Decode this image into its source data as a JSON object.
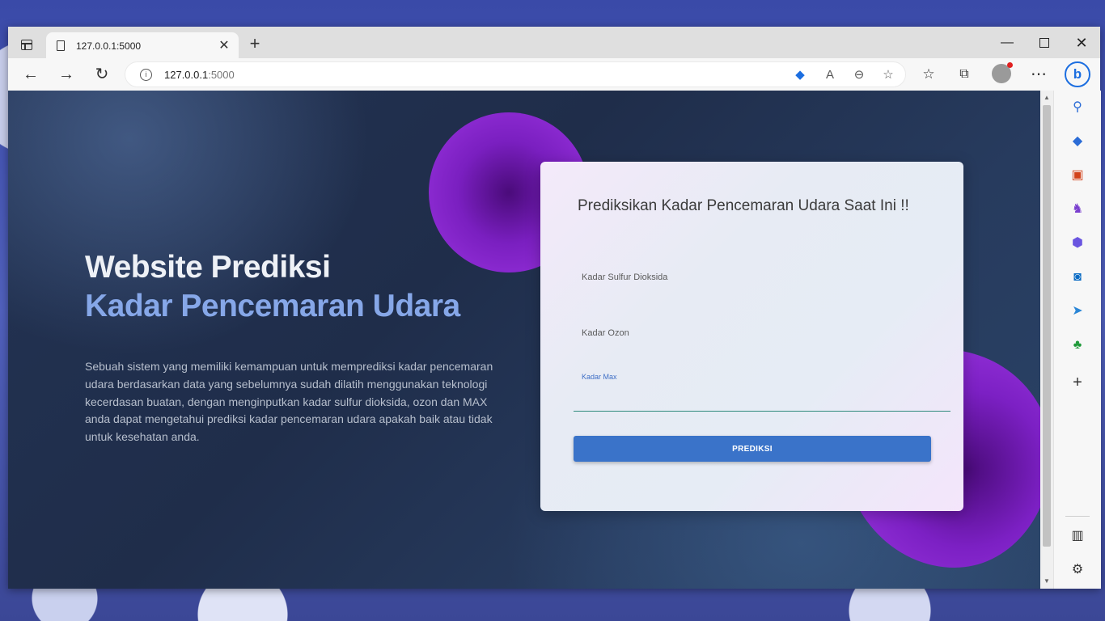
{
  "browser": {
    "tab": {
      "title": "127.0.0.1:5000"
    },
    "address": {
      "host": "127.0.0.1",
      "port": ":5000"
    },
    "buttons": {
      "back": "←",
      "forward": "→",
      "refresh": "↻",
      "new_tab": "+",
      "minimize": "—",
      "close": "✕",
      "more": "⋯",
      "tab_close": "✕"
    },
    "address_icons": [
      "coupon-tag-icon",
      "read-aloud-icon",
      "zoom-out-icon",
      "add-favorite-icon"
    ],
    "toolbar_icons": [
      "favorites-icon",
      "collections-icon",
      "profile-icon",
      "more-icon",
      "bing-copilot-icon"
    ]
  },
  "sidebar": {
    "items": [
      "search-icon",
      "shopping-tag-icon",
      "tools-icon",
      "games-icon",
      "office-icon",
      "outlook-icon",
      "telegram-icon",
      "tree-icon",
      "add-icon"
    ],
    "bottom": [
      "split-screen-icon",
      "settings-icon"
    ]
  },
  "hero": {
    "title": "Website Prediksi",
    "subtitle": "Kadar Pencemaran Udara",
    "description": "Sebuah sistem yang memiliki kemampuan untuk memprediksi kadar pencemaran udara berdasarkan data yang sebelumnya sudah dilatih menggunakan teknologi kecerdasan buatan, dengan menginputkan kadar sulfur dioksida, ozon dan MAX anda dapat mengetahui prediksi kadar pencemaran udara apakah baik atau tidak untuk kesehatan anda."
  },
  "form": {
    "title": "Prediksikan Kadar Pencemaran Udara Saat Ini !!",
    "fields": [
      {
        "label": "Kadar Sulfur Dioksida",
        "value": ""
      },
      {
        "label": "Kadar Ozon",
        "value": ""
      },
      {
        "label": "Kadar Max",
        "value": ""
      }
    ],
    "submit_label": "PREDIKSI"
  },
  "colors": {
    "accent": "#3a73c9",
    "hero_subtitle": "#86a7e8",
    "blob": "#8a2be2",
    "field_underline": "#2f8a7c"
  }
}
